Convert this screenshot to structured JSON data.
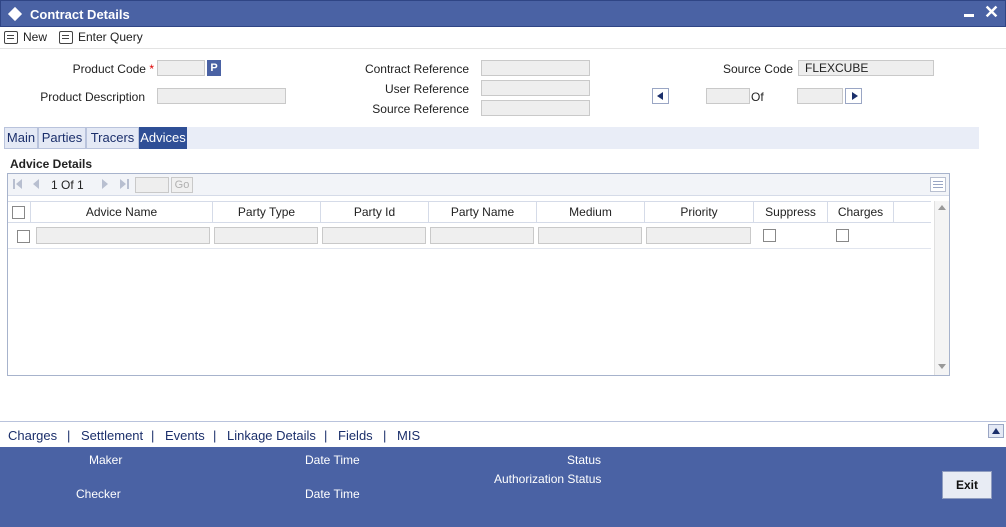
{
  "window": {
    "title": "Contract Details"
  },
  "toolbar": {
    "new_label": "New",
    "enter_query_label": "Enter Query"
  },
  "form": {
    "product_code_label": "Product Code",
    "required_mark": "*",
    "product_code_value": "",
    "p_button_label": "P",
    "product_description_label": "Product Description",
    "product_description_value": "",
    "contract_reference_label": "Contract Reference",
    "contract_reference_value": "",
    "user_reference_label": "User Reference",
    "user_reference_value": "",
    "source_reference_label": "Source Reference",
    "source_reference_value": "",
    "source_code_label": "Source Code",
    "source_code_value": "FLEXCUBE",
    "of_label": "Of",
    "current_record": "",
    "total_records": ""
  },
  "tabs": [
    {
      "label": "Main"
    },
    {
      "label": "Parties"
    },
    {
      "label": "Tracers"
    },
    {
      "label": "Advices",
      "active": true
    }
  ],
  "advices": {
    "section_title": "Advice Details",
    "pager_text": "1 Of 1",
    "go_label": "Go",
    "columns": [
      "Advice Name",
      "Party Type",
      "Party Id",
      "Party Name",
      "Medium",
      "Priority",
      "Suppress",
      "Charges"
    ],
    "rows": [
      {
        "advice_name": "",
        "party_type": "",
        "party_id": "",
        "party_name": "",
        "medium": "",
        "priority": "",
        "suppress": false,
        "charges": false
      }
    ]
  },
  "links": [
    "Charges",
    "Settlement",
    "Events",
    "Linkage Details",
    "Fields",
    "MIS"
  ],
  "link_separator": "|",
  "footer": {
    "maker_label": "Maker",
    "checker_label": "Checker",
    "date_time_label": "Date Time",
    "status_label": "Status",
    "authorization_status_label": "Authorization Status",
    "exit_label": "Exit"
  },
  "colors": {
    "brand": "#4a62a4",
    "active_tab": "#2f4f96",
    "link": "#1b2f6b",
    "required": "#dd0000"
  }
}
